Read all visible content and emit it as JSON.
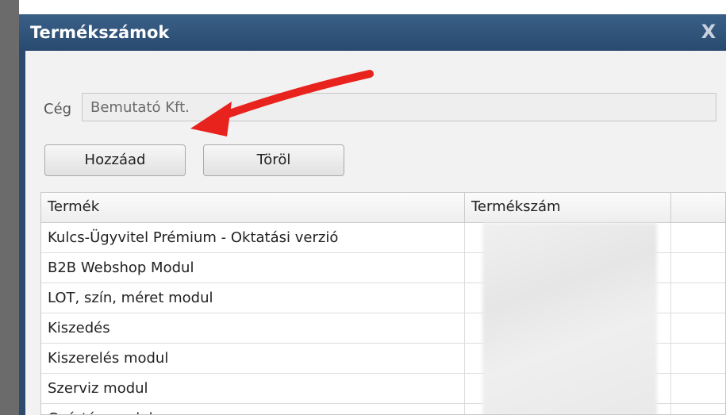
{
  "window": {
    "title": "Termékszámok",
    "close_glyph": "X"
  },
  "form": {
    "company_label": "Cég",
    "company_value": "Bemutató Kft."
  },
  "toolbar": {
    "add_label": "Hozzáad",
    "delete_label": "Töröl"
  },
  "grid": {
    "columns": [
      "Termék",
      "Termékszám",
      ""
    ],
    "rows": [
      {
        "product": "Kulcs-Ügyvitel Prémium - Oktatási verzió"
      },
      {
        "product": "B2B Webshop Modul"
      },
      {
        "product": "LOT, szín, méret modul"
      },
      {
        "product": "Kiszedés"
      },
      {
        "product": "Kiszerelés modul"
      },
      {
        "product": "Szerviz modul"
      },
      {
        "product": "Gyártás modul"
      }
    ]
  },
  "annotation": {
    "arrow_color": "#e8221c"
  }
}
